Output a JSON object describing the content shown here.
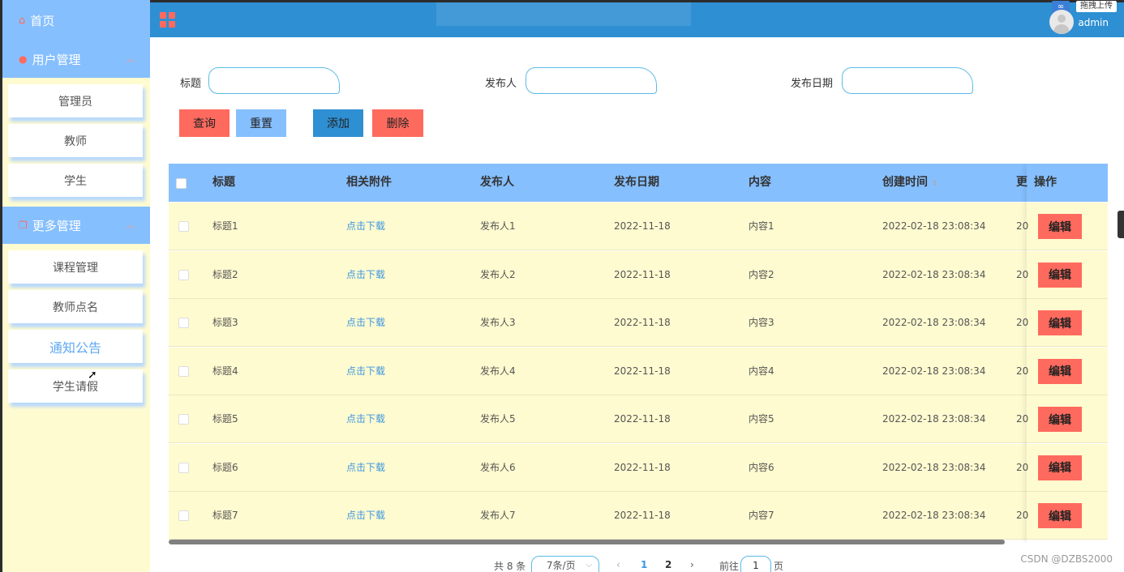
{
  "sidebar": {
    "home": "首页",
    "groups": [
      {
        "label": "用户管理",
        "items": [
          "管理员",
          "教师",
          "学生"
        ]
      },
      {
        "label": "更多管理",
        "items": [
          "课程管理",
          "教师点名",
          "通知公告",
          "学生请假"
        ]
      }
    ],
    "active_item": "通知公告"
  },
  "topbar": {
    "username": "admin",
    "upload_label": "拖拽上传"
  },
  "search": {
    "title_label": "标题",
    "publisher_label": "发布人",
    "date_label": "发布日期",
    "query_btn": "查询",
    "reset_btn": "重置",
    "add_btn": "添加",
    "delete_btn": "删除"
  },
  "table": {
    "headers": [
      "标题",
      "相关附件",
      "发布人",
      "发布日期",
      "内容",
      "创建时间",
      "更",
      "操作"
    ],
    "rows": [
      {
        "title": "标题1",
        "attachment": "点击下载",
        "publisher": "发布人1",
        "date": "2022-11-18",
        "content": "内容1",
        "created": "2022-02-18 23:08:34",
        "partial": "20",
        "action": "编辑"
      },
      {
        "title": "标题2",
        "attachment": "点击下载",
        "publisher": "发布人2",
        "date": "2022-11-18",
        "content": "内容2",
        "created": "2022-02-18 23:08:34",
        "partial": "20",
        "action": "编辑"
      },
      {
        "title": "标题3",
        "attachment": "点击下载",
        "publisher": "发布人3",
        "date": "2022-11-18",
        "content": "内容3",
        "created": "2022-02-18 23:08:34",
        "partial": "20",
        "action": "编辑"
      },
      {
        "title": "标题4",
        "attachment": "点击下载",
        "publisher": "发布人4",
        "date": "2022-11-18",
        "content": "内容4",
        "created": "2022-02-18 23:08:34",
        "partial": "20",
        "action": "编辑"
      },
      {
        "title": "标题5",
        "attachment": "点击下载",
        "publisher": "发布人5",
        "date": "2022-11-18",
        "content": "内容5",
        "created": "2022-02-18 23:08:34",
        "partial": "20",
        "action": "编辑"
      },
      {
        "title": "标题6",
        "attachment": "点击下载",
        "publisher": "发布人6",
        "date": "2022-11-18",
        "content": "内容6",
        "created": "2022-02-18 23:08:34",
        "partial": "20",
        "action": "编辑"
      },
      {
        "title": "标题7",
        "attachment": "点击下载",
        "publisher": "发布人7",
        "date": "2022-11-18",
        "content": "内容7",
        "created": "2022-02-18 23:08:34",
        "partial": "20",
        "action": "编辑"
      }
    ]
  },
  "pagination": {
    "total": "共 8 条",
    "page_size": "7条/页",
    "pages": [
      "1",
      "2"
    ],
    "current": "1",
    "goto_label": "前往",
    "goto_value": "1",
    "page_suffix": "页"
  },
  "watermark": "CSDN @DZBS2000",
  "colors": {
    "primary": "#2e8fd3",
    "light_blue": "#86bffe",
    "accent_red": "#ff6a5e",
    "row_bg": "#fffbd0"
  }
}
